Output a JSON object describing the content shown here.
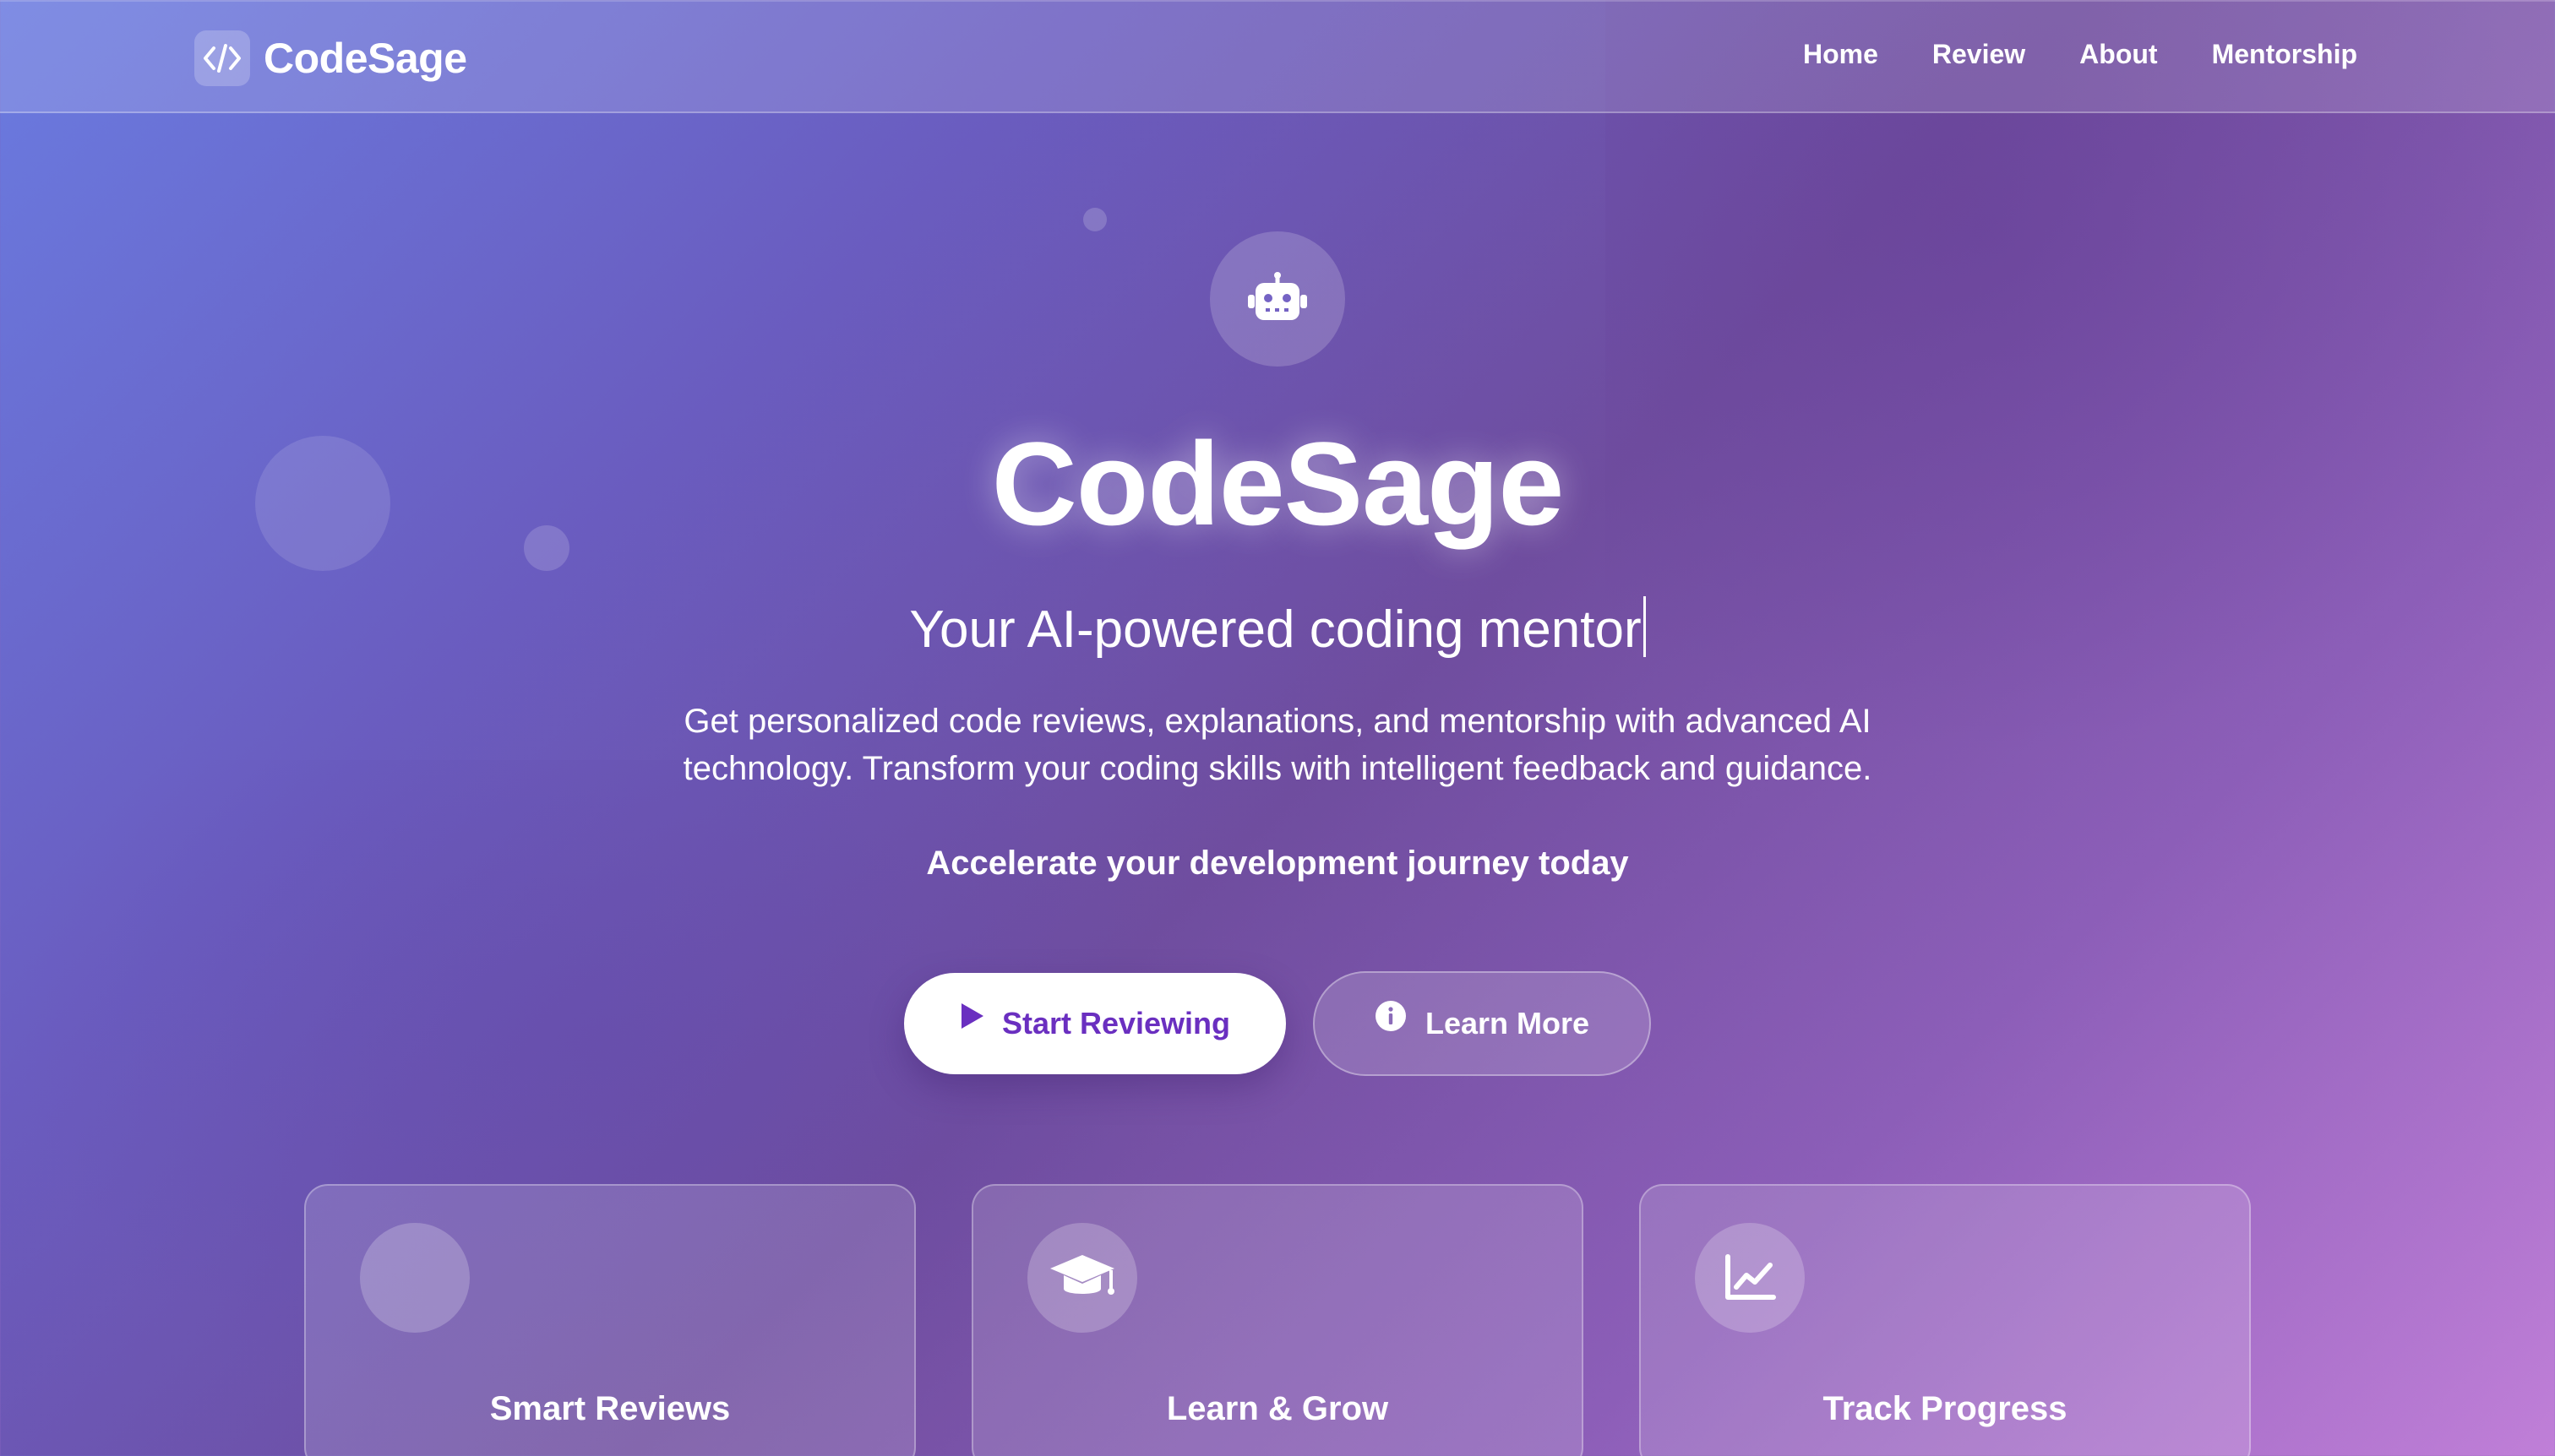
{
  "navbar": {
    "brand_name": "CodeSage",
    "brand_icon": "code-brackets-icon",
    "links": [
      {
        "label": "Home"
      },
      {
        "label": "Review"
      },
      {
        "label": "About"
      },
      {
        "label": "Mentorship"
      }
    ]
  },
  "hero": {
    "icon": "robot-icon",
    "title": "CodeSage",
    "subtitle": "Your AI-powered coding mentor",
    "description": "Get personalized code reviews, explanations, and mentorship with advanced AI technology. Transform your coding skills with intelligent feedback and guidance.",
    "tagline": "Accelerate your development journey today",
    "primary_button": {
      "label": "Start Reviewing",
      "icon": "play-icon",
      "color": "#6a2fc0"
    },
    "secondary_button": {
      "label": "Learn More",
      "icon": "info-icon"
    }
  },
  "features": [
    {
      "title": "Smart Reviews",
      "icon": "empty-circle"
    },
    {
      "title": "Learn & Grow",
      "icon": "graduation-cap-icon"
    },
    {
      "title": "Track Progress",
      "icon": "line-chart-icon"
    }
  ],
  "colors": {
    "gradient_start": "#6a7be0",
    "gradient_mid": "#6f4d9f",
    "gradient_end": "#c07fd8",
    "primary_text": "#6a2fc0"
  }
}
